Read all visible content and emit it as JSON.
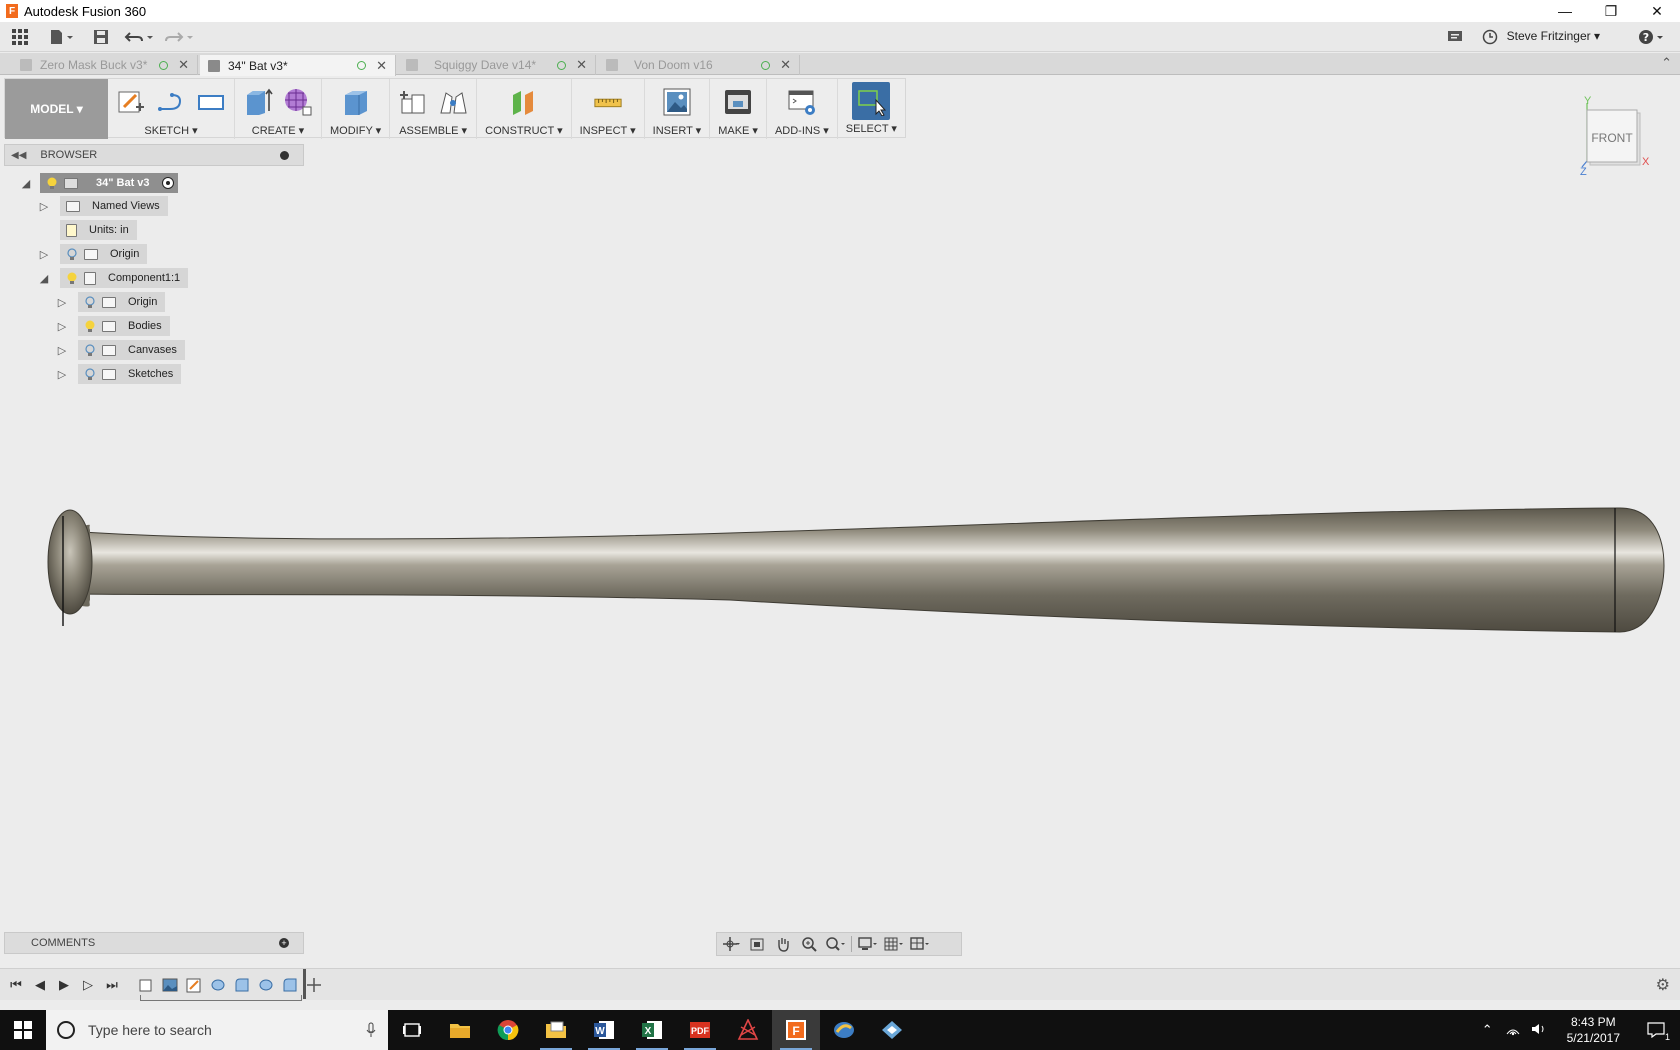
{
  "window": {
    "title": "Autodesk Fusion 360"
  },
  "appbar": {
    "user": "Steve Fritzinger ▾",
    "help": "?"
  },
  "tabs": [
    {
      "label": "Zero Mask Buck v3*",
      "active": false
    },
    {
      "label": "34\" Bat v3*",
      "active": true
    },
    {
      "label": "Squiggy Dave v14*",
      "active": false
    },
    {
      "label": "Von Doom v16",
      "active": false
    }
  ],
  "toolbar": {
    "workspace": "MODEL ▾",
    "groups": [
      {
        "label": "SKETCH ▾"
      },
      {
        "label": "CREATE ▾"
      },
      {
        "label": "MODIFY ▾"
      },
      {
        "label": "ASSEMBLE ▾"
      },
      {
        "label": "CONSTRUCT ▾"
      },
      {
        "label": "INSPECT ▾"
      },
      {
        "label": "INSERT ▾"
      },
      {
        "label": "MAKE ▾"
      },
      {
        "label": "ADD-INS ▾"
      },
      {
        "label": "SELECT ▾"
      }
    ]
  },
  "browser": {
    "title": "BROWSER",
    "root": "34\" Bat v3",
    "items": [
      {
        "label": "Named Views"
      },
      {
        "label": "Units: in"
      },
      {
        "label": "Origin"
      },
      {
        "label": "Component1:1"
      },
      {
        "label": "Origin"
      },
      {
        "label": "Bodies"
      },
      {
        "label": "Canvases"
      },
      {
        "label": "Sketches"
      }
    ]
  },
  "viewcube": {
    "face": "FRONT",
    "axis_x": "X",
    "axis_y": "Y",
    "axis_z": "Z"
  },
  "comments": {
    "title": "COMMENTS"
  },
  "taskbar": {
    "search_placeholder": "Type here to search",
    "time": "8:43 PM",
    "date": "5/21/2017",
    "notif_count": "1"
  },
  "colors": {
    "accent": "#3a6ea5",
    "root_pill": "#8f8f8f",
    "bat": "#6e6a5e"
  }
}
